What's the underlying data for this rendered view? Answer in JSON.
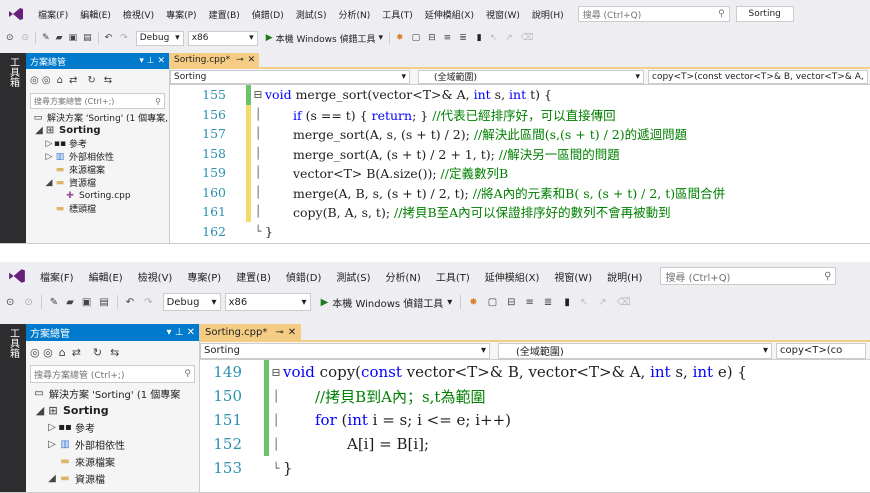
{
  "top": {
    "menu": [
      "檔案(F)",
      "編輯(E)",
      "檢視(V)",
      "專案(P)",
      "建置(B)",
      "偵錯(D)",
      "測試(S)",
      "分析(N)",
      "工具(T)",
      "延伸模組(X)",
      "視窗(W)",
      "說明(H)"
    ],
    "search_placeholder": "搜尋 (Ctrl+Q)",
    "sorting_label": "Sorting",
    "config": "Debug",
    "platform": "x86",
    "run_label": "本機 Windows 偵錯工具",
    "toolstrip": "工具箱",
    "se_title": "方案總管",
    "se_search": "搜尋方案總管 (Ctrl+;)",
    "tree": [
      "解決方案 'Sorting' (1 個專案,",
      "Sorting",
      "參考",
      "外部相依性",
      "來源檔案",
      "資源檔",
      "Sorting.cpp",
      "標頭檔"
    ],
    "tab": "Sorting.cpp*",
    "nav1": "Sorting",
    "nav2": "(全域範圍)",
    "nav3": "copy<T>(const vector<T>& B, vector<T>& A, in",
    "lines": [
      {
        "num": "155",
        "t": [
          [
            "c",
            "void "
          ],
          [
            "k",
            ""
          ],
          [
            "c",
            "merge_sort(vector<T>& A, "
          ],
          [
            "k",
            "int"
          ],
          [
            "c",
            " s, "
          ],
          [
            "k",
            "int"
          ],
          [
            "c",
            " t) {"
          ]
        ]
      },
      {
        "num": "156",
        "t": [
          [
            "k",
            "if"
          ],
          [
            "c",
            " (s == t) { "
          ],
          [
            "k",
            "return"
          ],
          [
            "c",
            "; } "
          ],
          [
            "m",
            "//代表已經排序好，可以直接傳回"
          ]
        ]
      },
      {
        "num": "157",
        "t": [
          [
            "c",
            "merge_sort(A, s, (s + t) / 2); "
          ],
          [
            "m",
            "//解決此區間(s,(s + t) / 2)的遞迴問題"
          ]
        ]
      },
      {
        "num": "158",
        "t": [
          [
            "c",
            "merge_sort(A, (s + t) / 2 + 1, t); "
          ],
          [
            "m",
            "//解決另一區間的問題"
          ]
        ]
      },
      {
        "num": "159",
        "t": [
          [
            "c",
            "vector<T> B(A.size()); "
          ],
          [
            "m",
            "//定義數列B"
          ]
        ]
      },
      {
        "num": "160",
        "t": [
          [
            "c",
            "merge(A, B, s, (s + t) / 2, t); "
          ],
          [
            "m",
            "//將A內的元素和B( s, (s + t) / 2, t)區間合併"
          ]
        ]
      },
      {
        "num": "161",
        "t": [
          [
            "c",
            "copy(B, A, s, t); "
          ],
          [
            "m",
            "//拷貝B至A內可以保證排序好的數列不會再被動到"
          ]
        ]
      },
      {
        "num": "162",
        "t": [
          [
            "c",
            "}"
          ]
        ]
      }
    ]
  },
  "bottom": {
    "menu": [
      "檔案(F)",
      "編輯(E)",
      "檢視(V)",
      "專案(P)",
      "建置(B)",
      "偵錯(D)",
      "測試(S)",
      "分析(N)",
      "工具(T)",
      "延伸模組(X)",
      "視窗(W)",
      "說明(H)"
    ],
    "search_placeholder": "搜尋 (Ctrl+Q)",
    "config": "Debug",
    "platform": "x86",
    "run_label": "本機 Windows 偵錯工具",
    "toolstrip": "工具箱",
    "se_title": "方案總管",
    "se_search": "搜尋方案總管 (Ctrl+;)",
    "tree": [
      "解決方案 'Sorting' (1 個專案",
      "Sorting",
      "參考",
      "外部相依性",
      "來源檔案",
      "資源檔"
    ],
    "tab": "Sorting.cpp*",
    "nav1": "Sorting",
    "nav2": "(全域範圍)",
    "nav3": "copy<T>(co",
    "lines": [
      {
        "num": "149",
        "t": [
          [
            "k",
            "void"
          ],
          [
            "c",
            " copy("
          ],
          [
            "k",
            "const"
          ],
          [
            "c",
            " vector<T>& B, vector<T>& A, "
          ],
          [
            "k",
            "int"
          ],
          [
            "c",
            " s, "
          ],
          [
            "k",
            "int"
          ],
          [
            "c",
            " e) {"
          ]
        ]
      },
      {
        "num": "150",
        "t": [
          [
            "m",
            "//拷貝B到A內；s,t為範圍"
          ]
        ]
      },
      {
        "num": "151",
        "t": [
          [
            "k",
            "for"
          ],
          [
            "c",
            " ("
          ],
          [
            "k",
            "int"
          ],
          [
            "c",
            " i = s; i <= e; i++)"
          ]
        ]
      },
      {
        "num": "152",
        "t": [
          [
            "c",
            "A[i] = B[i];"
          ]
        ]
      },
      {
        "num": "153",
        "t": [
          [
            "c",
            "}"
          ]
        ]
      }
    ]
  },
  "colors": {
    "accent": "#007acc",
    "tab": "#f5cc84",
    "keyword": "#0000ff",
    "comment": "#008000",
    "linenum": "#2b91af",
    "change_bar": "#6bc26b"
  }
}
